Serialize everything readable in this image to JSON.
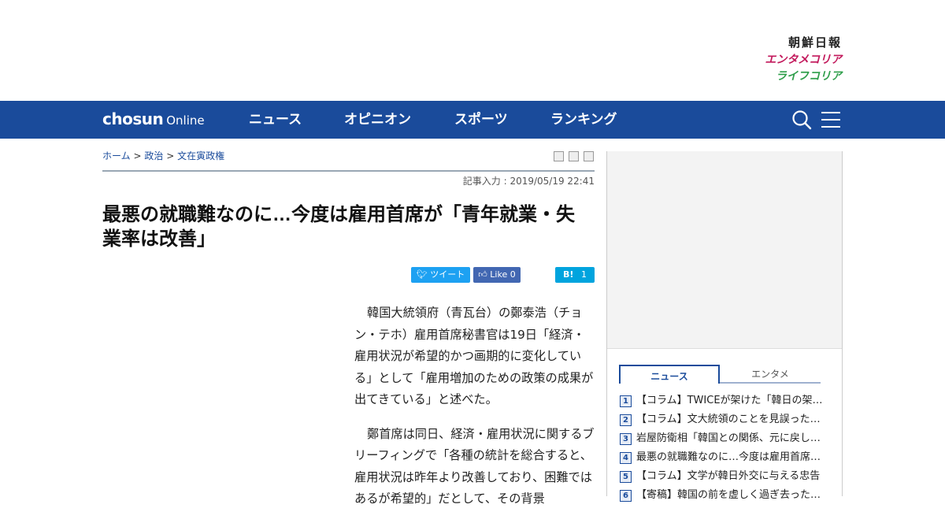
{
  "brand": {
    "chosun_ilbo": "朝鮮日報",
    "entame_korea": "エンタメコリア",
    "life_korea": "ライフコリア"
  },
  "nav": {
    "logo_bold": "chosun",
    "logo_regular": "Online",
    "items": [
      "ニュース",
      "オピニオン",
      "スポーツ",
      "ランキング"
    ]
  },
  "breadcrumb": {
    "home": "ホーム",
    "sep": ">",
    "section": "政治",
    "subsection": "文在寅政権"
  },
  "article": {
    "dateline": "記事入力 : 2019/05/19 22:41",
    "headline": "最悪の就職難なのに…今度は雇用首席が「青年就業・失業率は改善」",
    "paragraphs": [
      "韓国大統領府（青瓦台）の鄭泰浩（チョン・テホ）雇用首席秘書官は19日「経済・雇用状況が希望的かつ画期的に変化している」として「雇用増加のための政策の成果が出てきている」と述べた。",
      "鄭首席は同日、経済・雇用状況に関するブリーフィングで「各種の統計を総合すると、雇用状況は昨年より改善しており、困難ではあるが希望的」だとして、その背景"
    ]
  },
  "share": {
    "tweet": "ツイート",
    "like": "Like",
    "like_count": "0",
    "hatena": "B!",
    "hatena_count": "1"
  },
  "sidebar": {
    "tabs": [
      "ニュース",
      "エンタメ"
    ],
    "ranking": [
      {
        "rank": "1",
        "title": "【コラム】TWICEが架けた「韓日の架…"
      },
      {
        "rank": "2",
        "title": "【コラム】文大統領のことを見誤った…"
      },
      {
        "rank": "3",
        "title": "岩屋防衛相「韓国との関係、元に戻し…"
      },
      {
        "rank": "4",
        "title": "最悪の就職難なのに…今度は雇用首席…"
      },
      {
        "rank": "5",
        "title": "【コラム】文学が韓日外交に与える忠告"
      },
      {
        "rank": "6",
        "title": "【寄稿】韓国の前を虚しく過ぎ去った…"
      }
    ]
  },
  "colors": {
    "nav_bg": "#1a4b9b",
    "link": "#1a4b9b",
    "twitter": "#1da1f2",
    "facebook": "#4267b2",
    "hatena": "#00a4de",
    "entame": "#c2185b",
    "life": "#2e9e4a"
  }
}
